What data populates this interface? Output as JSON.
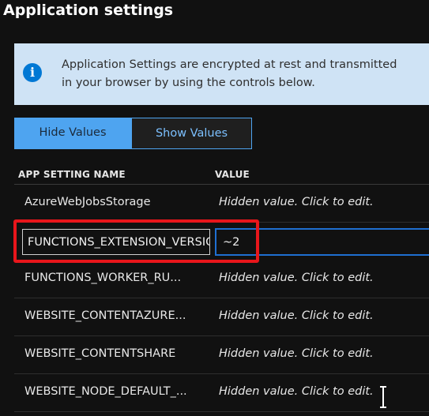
{
  "page": {
    "title": "Application settings"
  },
  "info": {
    "icon": "info-icon",
    "text": "Application Settings are encrypted at rest and transmitted\nin your browser by using the controls below."
  },
  "toggle": {
    "hide_label": "Hide Values",
    "show_label": "Show Values",
    "selected": "Hide Values"
  },
  "table": {
    "headers": {
      "name": "APP SETTING NAME",
      "value": "VALUE"
    },
    "rows": [
      {
        "name": "AzureWebJobsStorage",
        "value": "Hidden value. Click to edit."
      },
      {
        "name": "FUNCTIONS_EXTENSION_VERSION",
        "value": "~2"
      },
      {
        "name": "FUNCTIONS_WORKER_RU...",
        "value": "Hidden value. Click to edit."
      },
      {
        "name": "WEBSITE_CONTENTAZURE...",
        "value": "Hidden value. Click to edit."
      },
      {
        "name": "WEBSITE_CONTENTSHARE",
        "value": "Hidden value. Click to edit."
      },
      {
        "name": "WEBSITE_NODE_DEFAULT_...",
        "value": "Hidden value. Click to edit."
      }
    ]
  },
  "colors": {
    "accent": "#4ea4f0",
    "highlight": "#e8161b",
    "banner": "#cfe3f5"
  }
}
